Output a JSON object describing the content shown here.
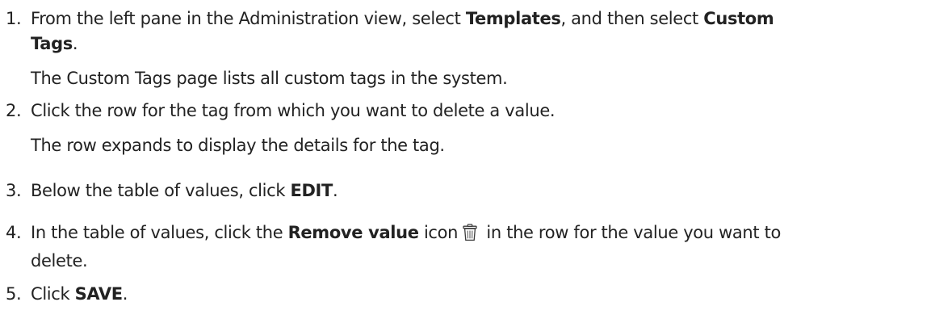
{
  "steps": [
    {
      "number": "1.",
      "parts": [
        "From the left pane in the Administration view, select ",
        "Templates",
        ", and then select ",
        "Custom",
        "Tags",
        "."
      ],
      "note": "The Custom Tags page lists all custom tags in the system."
    },
    {
      "number": "2.",
      "text": "Click the row for the tag from which you want to delete a value.",
      "note": "The row expands to display the details for the tag."
    },
    {
      "number": "3.",
      "parts": [
        "Below the table of values, click ",
        "EDIT",
        "."
      ]
    },
    {
      "number": "4.",
      "parts": [
        "In the table of values, click the ",
        "Remove value",
        " icon",
        " in the row for the value you want to",
        "delete."
      ],
      "icon": "trash-icon"
    },
    {
      "number": "5.",
      "parts": [
        "Click ",
        "SAVE",
        "."
      ]
    }
  ]
}
